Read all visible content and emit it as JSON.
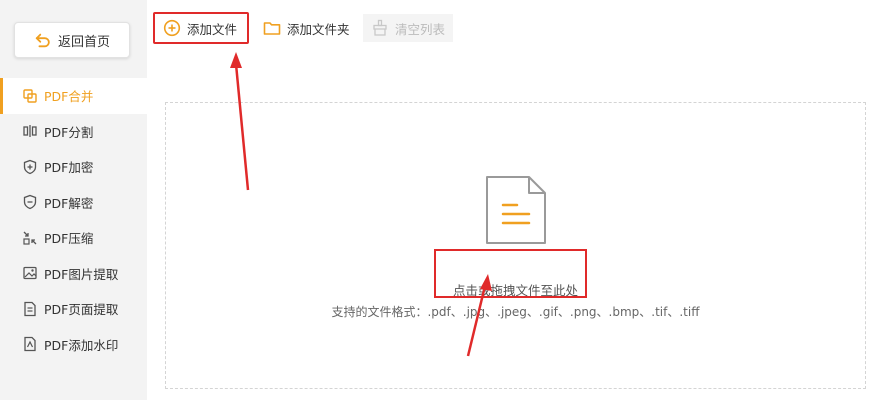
{
  "sidebar": {
    "back_label": "返回首页",
    "items": [
      {
        "label": "PDF合并",
        "icon": "merge-icon",
        "active": true
      },
      {
        "label": "PDF分割",
        "icon": "split-icon",
        "active": false
      },
      {
        "label": "PDF加密",
        "icon": "shield-plus-icon",
        "active": false
      },
      {
        "label": "PDF解密",
        "icon": "shield-minus-icon",
        "active": false
      },
      {
        "label": "PDF压缩",
        "icon": "compress-icon",
        "active": false
      },
      {
        "label": "PDF图片提取",
        "icon": "image-icon",
        "active": false
      },
      {
        "label": "PDF页面提取",
        "icon": "page-icon",
        "active": false
      },
      {
        "label": "PDF添加水印",
        "icon": "watermark-icon",
        "active": false
      }
    ]
  },
  "toolbar": {
    "add_file_label": "添加文件",
    "add_folder_label": "添加文件夹",
    "clear_list_label": "清空列表"
  },
  "drop_zone": {
    "hint": "点击或拖拽文件至此处",
    "formats": "支持的文件格式：.pdf、.jpg、.jpeg、.gif、.png、.bmp、.tif、.tiff"
  },
  "colors": {
    "accent": "#f0a020",
    "highlight_red": "#e02a2a"
  }
}
